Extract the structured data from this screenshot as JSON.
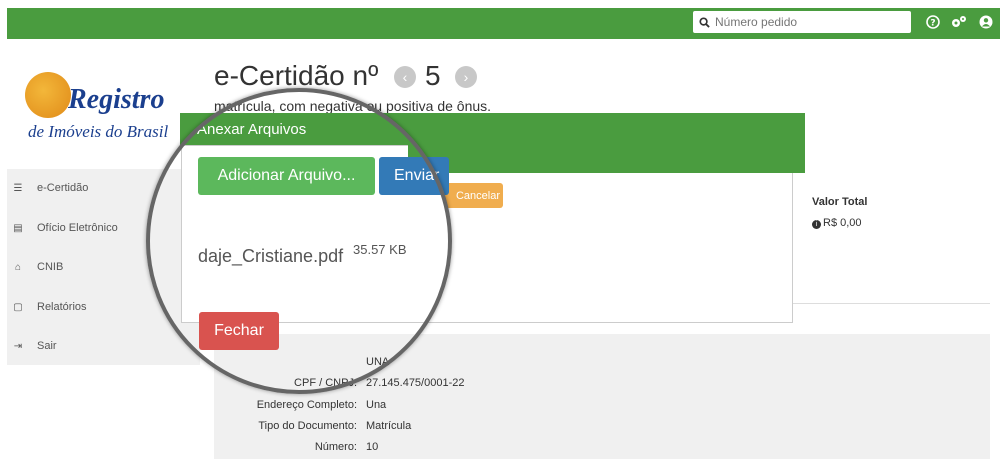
{
  "header": {
    "search_placeholder": "Número pedido",
    "icons": [
      "search-icon",
      "help-icon",
      "settings-icon",
      "user-icon"
    ]
  },
  "logo": {
    "title": "Registro",
    "subtitle": "de Imóveis do Brasil"
  },
  "sidebar": {
    "items": [
      {
        "label": "e-Certidão",
        "icon": "list-icon"
      },
      {
        "label": "Ofício Eletrônico",
        "icon": "document-icon"
      },
      {
        "label": "CNIB",
        "icon": "home-icon"
      },
      {
        "label": "Relatórios",
        "icon": "file-icon"
      },
      {
        "label": "Sair",
        "icon": "sign-out-icon"
      }
    ]
  },
  "main": {
    "title": "e-Certidão nº",
    "number": "5",
    "subtitle": "matrícula, com negativa ou positiva de ônus.",
    "valor_total_label": "Valor Total",
    "valor_total_value": "R$ 0,00",
    "details": [
      {
        "label": "CPF / CNPJ:",
        "value": "27.145.475/0001-22"
      },
      {
        "label": "Endereço Completo:",
        "value": "Una"
      },
      {
        "label": "Tipo do Documento:",
        "value": "Matrícula"
      },
      {
        "label": "Número:",
        "value": "10"
      }
    ],
    "partial_name_value": "UNA"
  },
  "modal": {
    "title": "Anexar Arquivos",
    "add_button": "Adicionar Arquivo...",
    "send_button": "Enviar",
    "cancel_button": "Cancelar",
    "file_name": "daje_Cristiane.pdf",
    "file_size": "35.57 KB",
    "close_button": "Fechar"
  },
  "colors": {
    "brand_green": "#4a9c3f",
    "success": "#5cb85c",
    "primary": "#337ab7",
    "warning": "#f0ad4e",
    "danger": "#d9534f"
  }
}
